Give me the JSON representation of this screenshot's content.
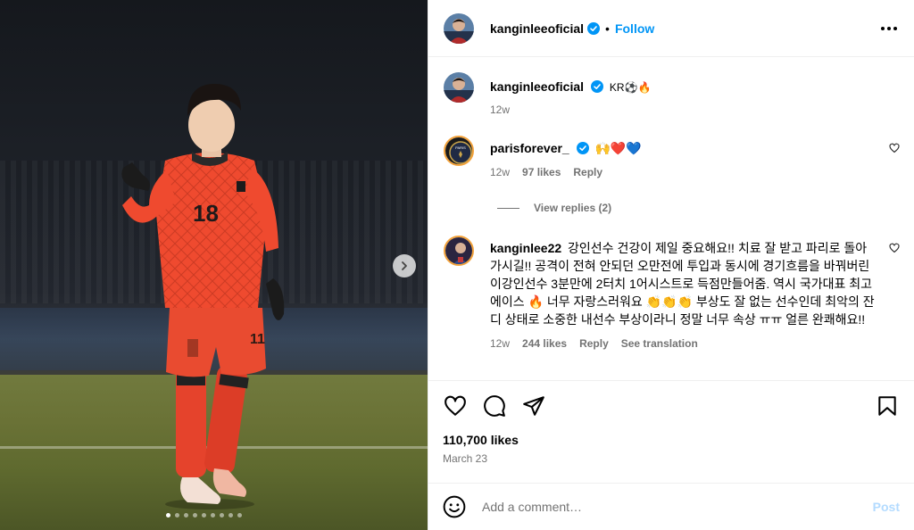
{
  "post": {
    "author": "kanginleeoficial",
    "follow_label": "Follow",
    "separator": "•"
  },
  "media": {
    "jersey_number": "18",
    "carousel_total": 9,
    "carousel_active": 1
  },
  "caption": {
    "author": "kanginleeoficial",
    "text": "KR⚽🔥",
    "age": "12w"
  },
  "comments": [
    {
      "author": "parisforever_",
      "text": "🙌❤️💙",
      "age": "12w",
      "likes": "97 likes",
      "reply_label": "Reply",
      "view_replies": "View replies (2)"
    },
    {
      "author": "kanginlee22",
      "text": "강인선수 건강이 제일 중요해요!! 치료 잘 받고 파리로 돌아가시길!! 공격이 전혀 안되던 오만전에 투입과 동시에 경기흐름을 바꿔버린 이강인선수 3분만에 2터치 1어시스트로 득점만들어줌. 역시 국가대표 최고 에이스 🔥 너무 자랑스러워요 👏👏👏 부상도 잘 없는 선수인데 최악의 잔디 상태로 소중한 내선수 부상이라니 정말 너무 속상 ㅠㅠ 얼른 완쾌해요!!",
      "age": "12w",
      "likes": "244 likes",
      "reply_label": "Reply",
      "translation_label": "See translation"
    }
  ],
  "stats": {
    "likes": "110,700 likes",
    "date": "March 23"
  },
  "composer": {
    "placeholder": "Add a comment…",
    "post_label": "Post"
  },
  "colors": {
    "accent": "#0095f6",
    "post_disabled": "#b3dbff",
    "muted": "#737373",
    "verified": "#0095f6",
    "jersey": "#ef4a2f"
  },
  "icons": [
    "verified-badge-icon",
    "more-options-icon",
    "heart-icon",
    "comment-icon",
    "share-icon",
    "bookmark-icon",
    "emoji-icon",
    "chevron-right-icon"
  ]
}
